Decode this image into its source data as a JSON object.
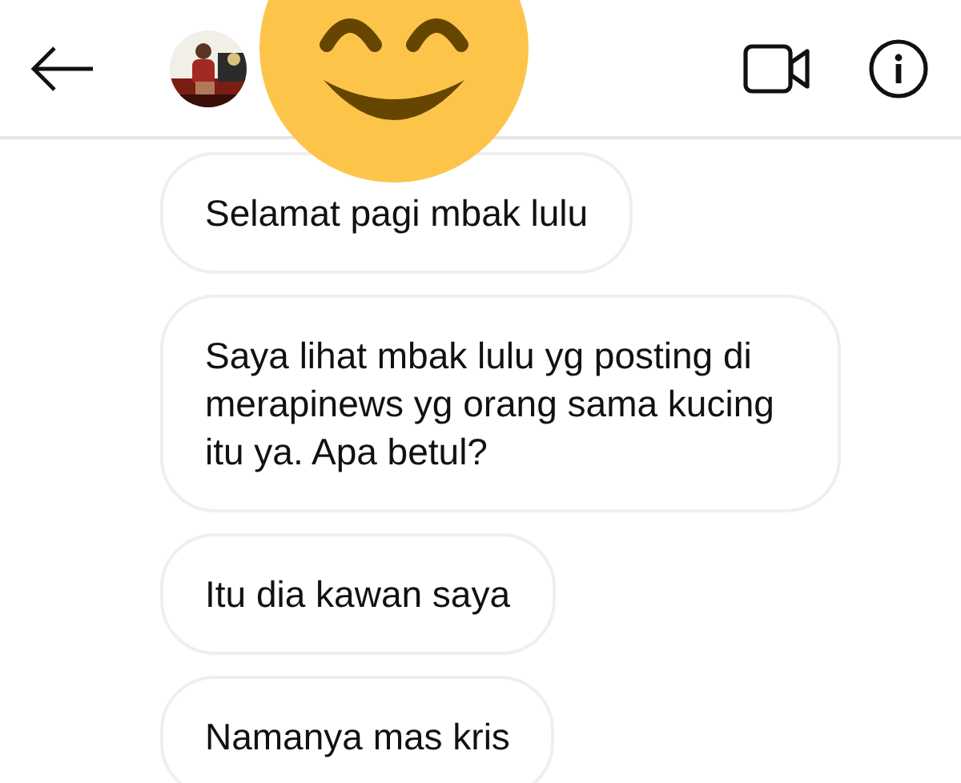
{
  "messages": [
    {
      "text": "Selamat pagi mbak lulu"
    },
    {
      "text": "Saya lihat mbak lulu yg posting di merapinews yg orang sama kucing itu ya. Apa betul?"
    },
    {
      "text": "Itu dia kawan saya"
    },
    {
      "text": "Namanya mas kris"
    }
  ]
}
